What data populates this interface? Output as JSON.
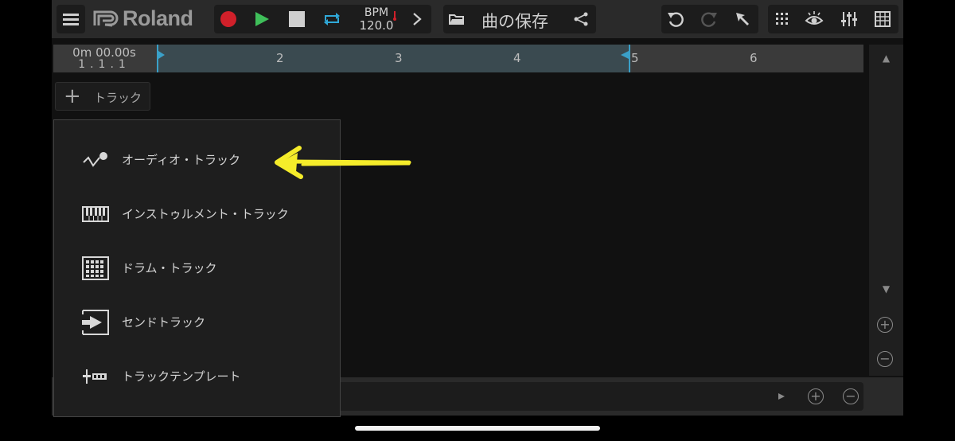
{
  "toolbar": {
    "logo_text": "Roland",
    "bpm_label": "BPM",
    "bpm_value": "120.0",
    "save_label": "曲の保存"
  },
  "timeline": {
    "time": "0m 00.00s",
    "position": "1.1.1",
    "bars": [
      "2",
      "3",
      "4",
      "5",
      "6"
    ]
  },
  "add_track_label": "トラック",
  "menu": {
    "items": [
      {
        "label": "オーディオ・トラック",
        "icon": "microphone-icon"
      },
      {
        "label": "インストゥルメント・トラック",
        "icon": "piano-keys-icon"
      },
      {
        "label": "ドラム・トラック",
        "icon": "drum-pads-icon"
      },
      {
        "label": "センドトラック",
        "icon": "send-icon"
      },
      {
        "label": "トラックテンプレート",
        "icon": "template-icon"
      }
    ]
  },
  "colors": {
    "record": "#d0202a",
    "play": "#3fbf5a",
    "loop": "#2fa8d8",
    "annotation_arrow": "#f5ec2a",
    "loop_region": "#3a4a50"
  }
}
